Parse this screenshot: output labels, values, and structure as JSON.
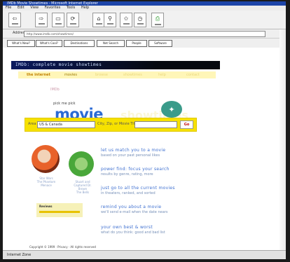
{
  "browser": {
    "title": "IMDb Movie Showtimes - Microsoft Internet Explorer",
    "menu": [
      "File",
      "Edit",
      "View",
      "Favorites",
      "Tools",
      "Help"
    ],
    "toolbar": [
      "Back",
      "Forward",
      "Stop",
      "Refresh",
      "Home",
      "Search",
      "Favorites",
      "History",
      "Print"
    ],
    "address_label": "Address",
    "address_value": "http://www.imdb.com/showtimes/",
    "links": [
      "What's New?",
      "What's Cool?",
      "Destinations",
      "Net Search",
      "People",
      "Software"
    ],
    "status": "Internet Zone"
  },
  "page": {
    "banner": "IMDb: complete movie showtimes",
    "nav": [
      "the internet",
      "movies",
      "browse",
      "showtimes",
      "help",
      "contact"
    ],
    "logo": "IMDb",
    "tagline": "pick me  pick",
    "brand_main": "movie",
    "brand_secondary": "showtimes",
    "search": {
      "label1": "Area",
      "select_value": "US & Canada",
      "label2": "City, Zip, or Movie Title",
      "button": "Go"
    },
    "pics": [
      {
        "caption": "Star Wars\nThe Phantom Menace"
      },
      {
        "caption": "Stuart and\nCaptured Dr.\nBrown\nThe Bells"
      }
    ],
    "promo_title": "Reviews",
    "features": [
      {
        "heading": "let us match you to a movie",
        "sub": "based on your past personal likes"
      },
      {
        "heading": "power find: focus your search",
        "sub": "results by genre, rating, more"
      },
      {
        "heading": "just go to all the current movies",
        "sub": "in theaters, ranked, and sorted"
      },
      {
        "heading": "remind you about a movie",
        "sub": "we'll send e-mail when the date nears"
      },
      {
        "heading": "your own best & worst",
        "sub": "what do you think: good and bad list"
      }
    ],
    "footer": "Copyright © 1999 · Privacy · All rights reserved"
  }
}
